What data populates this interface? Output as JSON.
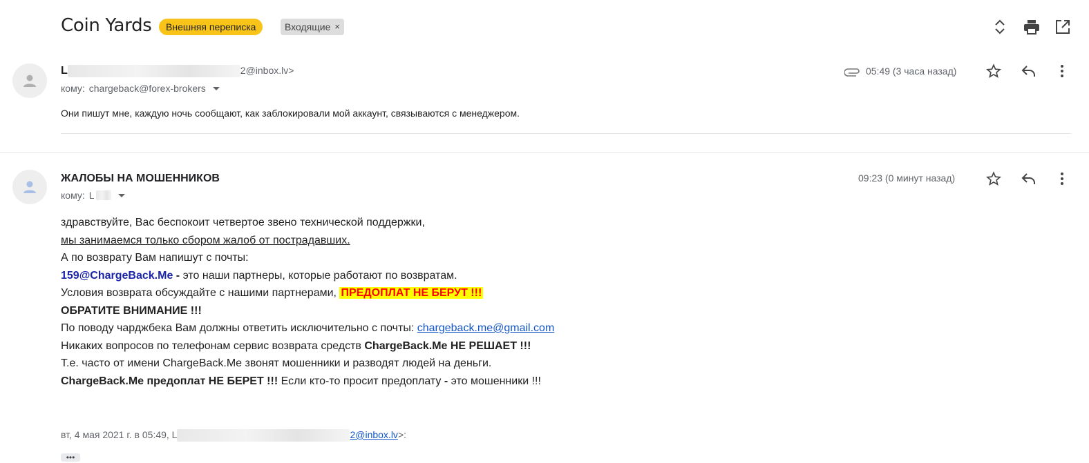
{
  "header": {
    "subject": "Coin Yards",
    "labels": [
      {
        "text": "Внешняя переписка",
        "color": "#f8c41a"
      },
      {
        "text": "Входящие",
        "removable": true,
        "remove_glyph": "×"
      }
    ],
    "icons": [
      "expand-collapse-icon",
      "print-icon",
      "open-new-window-icon"
    ]
  },
  "messages": [
    {
      "sender_prefix": "L",
      "sender_email_suffix": "2@inbox.lv>",
      "to_prefix": "кому:",
      "to_value": "chargeback@forex-brokers",
      "has_attachment": true,
      "time": "05:49 (3 часа назад)",
      "snippet": "Они пишут мне, каждую ночь сообщают, как заблокировали мой аккаунт, связываются с менеджером."
    },
    {
      "sender": "ЖАЛОБЫ НА МОШЕННИКОВ",
      "to_prefix": "кому:",
      "to_value": "L",
      "time": "09:23 (0 минут назад)",
      "body": {
        "l1": "здравствуйте, Вас беспокоит четвертое звено технической поддержки,",
        "l2": "мы занимаемся только сбором жалоб от пострадавших.",
        "l3": "А по возврату Вам напишут с почты:",
        "l4_bold": "159@ChargeBack.Me",
        "l4_dash": " - ",
        "l4_rest": "это наши партнеры, которые работают по возвратам.",
        "l5_text": "Условия возврата обсуждайте с нашими партнерами, ",
        "l5_highlight": "ПРЕДОПЛАТ НЕ БЕРУТ !!!",
        "l6": "ОБРАТИТЕ ВНИМАНИЕ !!!",
        "l7_text": "По поводу чарджбека Вам должны ответить исключительно с почты: ",
        "l7_link": "chargeback.me@gmail.com",
        "l8_text": "Никаких вопросов по телефонам сервис возврата средств ",
        "l8_bold": "ChargeBack.Me НЕ РЕШАЕТ !!!",
        "l9": "Т.е. часто от имени ChargeBack.Me звонят мошенники и разводят людей на деньги.",
        "l10_bold": "ChargeBack.Me предоплат НЕ БЕРЕТ !!!",
        "l10_text": " Если кто-то просит предоплату ",
        "l10_dash": "-",
        "l10_end": " это мошенники !!!"
      },
      "quote_prefix": "вт, 4 мая 2021 г. в 05:49, L",
      "quote_email": "2@inbox.lv",
      "quote_suffix": ">:",
      "show_trimmed": "•••"
    }
  ],
  "colors": {
    "label_external": "#f8c41a",
    "highlight_bg": "#ffff00",
    "highlight_text": "#ff0000",
    "link": "#1155cc",
    "bold_link": "#1a24a8"
  }
}
